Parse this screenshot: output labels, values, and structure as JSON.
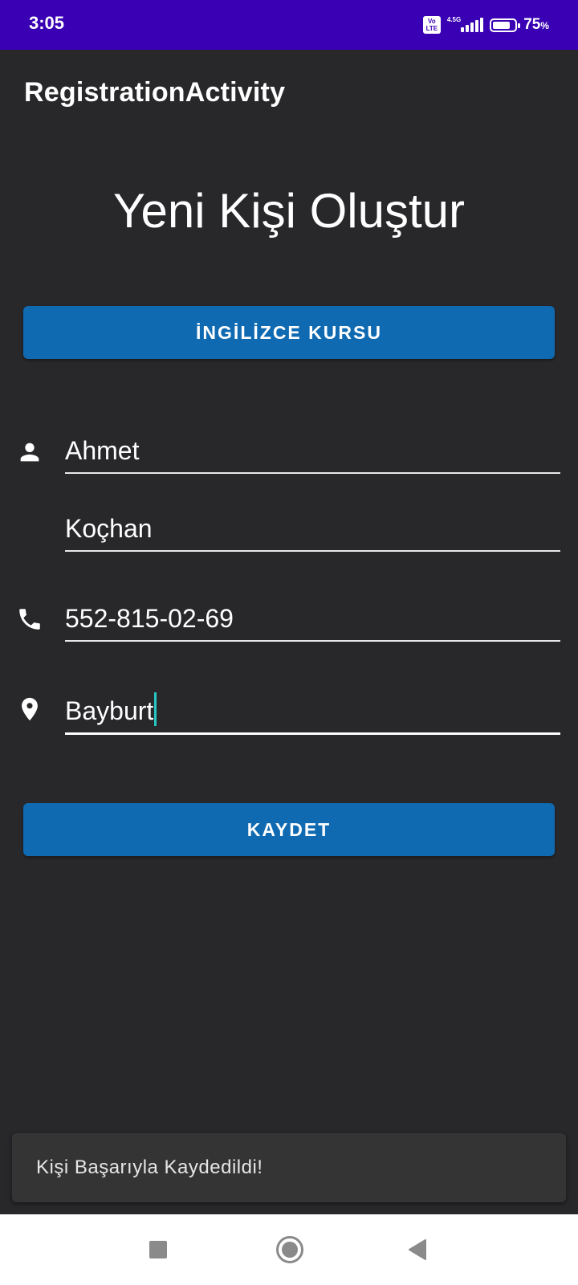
{
  "status_bar": {
    "time": "3:05",
    "volte_line1": "Vo",
    "volte_line2": "LTE",
    "network": "4.5G",
    "battery_level": 75,
    "battery_percent": "75",
    "battery_unit": "%",
    "icons": [
      "volte-icon",
      "signal-icon",
      "battery-icon"
    ]
  },
  "app_bar": {
    "title": "RegistrationActivity"
  },
  "main": {
    "heading": "Yeni Kişi Oluştur",
    "course_button": "İNGİLİZCE KURSU",
    "fields": {
      "first_name": {
        "value": "Ahmet",
        "icon": "person-icon"
      },
      "last_name": {
        "value": "Koçhan"
      },
      "phone": {
        "value": "552-815-02-69",
        "icon": "phone-icon"
      },
      "city": {
        "value": "Bayburt",
        "icon": "location-pin-icon"
      }
    },
    "save_button": "KAYDET"
  },
  "toast": {
    "message": "Kişi Başarıyla Kaydedildi!"
  },
  "nav_bar": {
    "icons": [
      "recent-apps-icon",
      "home-icon",
      "back-icon"
    ]
  },
  "colors": {
    "status_bar": "#3a00b4",
    "background": "#28282b",
    "button": "#0f6ab2",
    "cursor": "#26c6c2",
    "toast": "#343434"
  }
}
